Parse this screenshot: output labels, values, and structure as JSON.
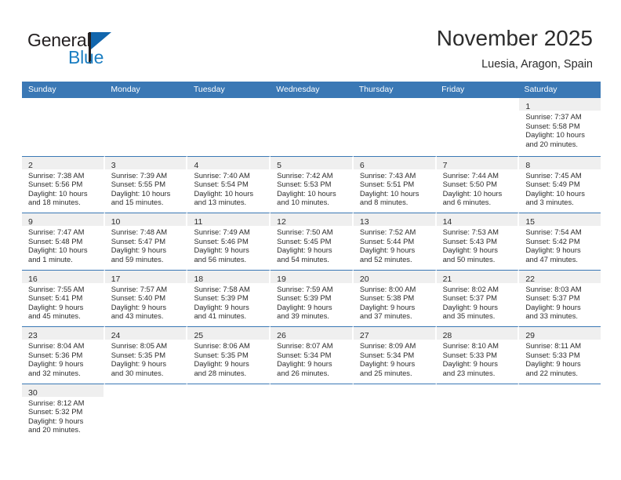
{
  "brand": {
    "name_part1": "General",
    "name_part2": "Blue",
    "accent_color": "#1b7ec2",
    "flag_color": "#1266ad"
  },
  "header": {
    "title": "November 2025",
    "subtitle": "Luesia, Aragon, Spain"
  },
  "theme": {
    "header_bar_color": "#3a78b5",
    "daynum_band_color": "#efefef",
    "row_separator_color": "#3a78b5",
    "text_color": "#2c2c2c"
  },
  "weekdays": [
    "Sunday",
    "Monday",
    "Tuesday",
    "Wednesday",
    "Thursday",
    "Friday",
    "Saturday"
  ],
  "weeks": [
    [
      {
        "day": "",
        "sunrise": "",
        "sunset": "",
        "daylight1": "",
        "daylight2": "",
        "empty": true
      },
      {
        "day": "",
        "sunrise": "",
        "sunset": "",
        "daylight1": "",
        "daylight2": "",
        "empty": true
      },
      {
        "day": "",
        "sunrise": "",
        "sunset": "",
        "daylight1": "",
        "daylight2": "",
        "empty": true
      },
      {
        "day": "",
        "sunrise": "",
        "sunset": "",
        "daylight1": "",
        "daylight2": "",
        "empty": true
      },
      {
        "day": "",
        "sunrise": "",
        "sunset": "",
        "daylight1": "",
        "daylight2": "",
        "empty": true
      },
      {
        "day": "",
        "sunrise": "",
        "sunset": "",
        "daylight1": "",
        "daylight2": "",
        "empty": true
      },
      {
        "day": "1",
        "sunrise": "Sunrise: 7:37 AM",
        "sunset": "Sunset: 5:58 PM",
        "daylight1": "Daylight: 10 hours",
        "daylight2": "and 20 minutes."
      }
    ],
    [
      {
        "day": "2",
        "sunrise": "Sunrise: 7:38 AM",
        "sunset": "Sunset: 5:56 PM",
        "daylight1": "Daylight: 10 hours",
        "daylight2": "and 18 minutes."
      },
      {
        "day": "3",
        "sunrise": "Sunrise: 7:39 AM",
        "sunset": "Sunset: 5:55 PM",
        "daylight1": "Daylight: 10 hours",
        "daylight2": "and 15 minutes."
      },
      {
        "day": "4",
        "sunrise": "Sunrise: 7:40 AM",
        "sunset": "Sunset: 5:54 PM",
        "daylight1": "Daylight: 10 hours",
        "daylight2": "and 13 minutes."
      },
      {
        "day": "5",
        "sunrise": "Sunrise: 7:42 AM",
        "sunset": "Sunset: 5:53 PM",
        "daylight1": "Daylight: 10 hours",
        "daylight2": "and 10 minutes."
      },
      {
        "day": "6",
        "sunrise": "Sunrise: 7:43 AM",
        "sunset": "Sunset: 5:51 PM",
        "daylight1": "Daylight: 10 hours",
        "daylight2": "and 8 minutes."
      },
      {
        "day": "7",
        "sunrise": "Sunrise: 7:44 AM",
        "sunset": "Sunset: 5:50 PM",
        "daylight1": "Daylight: 10 hours",
        "daylight2": "and 6 minutes."
      },
      {
        "day": "8",
        "sunrise": "Sunrise: 7:45 AM",
        "sunset": "Sunset: 5:49 PM",
        "daylight1": "Daylight: 10 hours",
        "daylight2": "and 3 minutes."
      }
    ],
    [
      {
        "day": "9",
        "sunrise": "Sunrise: 7:47 AM",
        "sunset": "Sunset: 5:48 PM",
        "daylight1": "Daylight: 10 hours",
        "daylight2": "and 1 minute."
      },
      {
        "day": "10",
        "sunrise": "Sunrise: 7:48 AM",
        "sunset": "Sunset: 5:47 PM",
        "daylight1": "Daylight: 9 hours",
        "daylight2": "and 59 minutes."
      },
      {
        "day": "11",
        "sunrise": "Sunrise: 7:49 AM",
        "sunset": "Sunset: 5:46 PM",
        "daylight1": "Daylight: 9 hours",
        "daylight2": "and 56 minutes."
      },
      {
        "day": "12",
        "sunrise": "Sunrise: 7:50 AM",
        "sunset": "Sunset: 5:45 PM",
        "daylight1": "Daylight: 9 hours",
        "daylight2": "and 54 minutes."
      },
      {
        "day": "13",
        "sunrise": "Sunrise: 7:52 AM",
        "sunset": "Sunset: 5:44 PM",
        "daylight1": "Daylight: 9 hours",
        "daylight2": "and 52 minutes."
      },
      {
        "day": "14",
        "sunrise": "Sunrise: 7:53 AM",
        "sunset": "Sunset: 5:43 PM",
        "daylight1": "Daylight: 9 hours",
        "daylight2": "and 50 minutes."
      },
      {
        "day": "15",
        "sunrise": "Sunrise: 7:54 AM",
        "sunset": "Sunset: 5:42 PM",
        "daylight1": "Daylight: 9 hours",
        "daylight2": "and 47 minutes."
      }
    ],
    [
      {
        "day": "16",
        "sunrise": "Sunrise: 7:55 AM",
        "sunset": "Sunset: 5:41 PM",
        "daylight1": "Daylight: 9 hours",
        "daylight2": "and 45 minutes."
      },
      {
        "day": "17",
        "sunrise": "Sunrise: 7:57 AM",
        "sunset": "Sunset: 5:40 PM",
        "daylight1": "Daylight: 9 hours",
        "daylight2": "and 43 minutes."
      },
      {
        "day": "18",
        "sunrise": "Sunrise: 7:58 AM",
        "sunset": "Sunset: 5:39 PM",
        "daylight1": "Daylight: 9 hours",
        "daylight2": "and 41 minutes."
      },
      {
        "day": "19",
        "sunrise": "Sunrise: 7:59 AM",
        "sunset": "Sunset: 5:39 PM",
        "daylight1": "Daylight: 9 hours",
        "daylight2": "and 39 minutes."
      },
      {
        "day": "20",
        "sunrise": "Sunrise: 8:00 AM",
        "sunset": "Sunset: 5:38 PM",
        "daylight1": "Daylight: 9 hours",
        "daylight2": "and 37 minutes."
      },
      {
        "day": "21",
        "sunrise": "Sunrise: 8:02 AM",
        "sunset": "Sunset: 5:37 PM",
        "daylight1": "Daylight: 9 hours",
        "daylight2": "and 35 minutes."
      },
      {
        "day": "22",
        "sunrise": "Sunrise: 8:03 AM",
        "sunset": "Sunset: 5:37 PM",
        "daylight1": "Daylight: 9 hours",
        "daylight2": "and 33 minutes."
      }
    ],
    [
      {
        "day": "23",
        "sunrise": "Sunrise: 8:04 AM",
        "sunset": "Sunset: 5:36 PM",
        "daylight1": "Daylight: 9 hours",
        "daylight2": "and 32 minutes."
      },
      {
        "day": "24",
        "sunrise": "Sunrise: 8:05 AM",
        "sunset": "Sunset: 5:35 PM",
        "daylight1": "Daylight: 9 hours",
        "daylight2": "and 30 minutes."
      },
      {
        "day": "25",
        "sunrise": "Sunrise: 8:06 AM",
        "sunset": "Sunset: 5:35 PM",
        "daylight1": "Daylight: 9 hours",
        "daylight2": "and 28 minutes."
      },
      {
        "day": "26",
        "sunrise": "Sunrise: 8:07 AM",
        "sunset": "Sunset: 5:34 PM",
        "daylight1": "Daylight: 9 hours",
        "daylight2": "and 26 minutes."
      },
      {
        "day": "27",
        "sunrise": "Sunrise: 8:09 AM",
        "sunset": "Sunset: 5:34 PM",
        "daylight1": "Daylight: 9 hours",
        "daylight2": "and 25 minutes."
      },
      {
        "day": "28",
        "sunrise": "Sunrise: 8:10 AM",
        "sunset": "Sunset: 5:33 PM",
        "daylight1": "Daylight: 9 hours",
        "daylight2": "and 23 minutes."
      },
      {
        "day": "29",
        "sunrise": "Sunrise: 8:11 AM",
        "sunset": "Sunset: 5:33 PM",
        "daylight1": "Daylight: 9 hours",
        "daylight2": "and 22 minutes."
      }
    ],
    [
      {
        "day": "30",
        "sunrise": "Sunrise: 8:12 AM",
        "sunset": "Sunset: 5:32 PM",
        "daylight1": "Daylight: 9 hours",
        "daylight2": "and 20 minutes."
      },
      {
        "day": "",
        "sunrise": "",
        "sunset": "",
        "daylight1": "",
        "daylight2": "",
        "empty": true
      },
      {
        "day": "",
        "sunrise": "",
        "sunset": "",
        "daylight1": "",
        "daylight2": "",
        "empty": true
      },
      {
        "day": "",
        "sunrise": "",
        "sunset": "",
        "daylight1": "",
        "daylight2": "",
        "empty": true
      },
      {
        "day": "",
        "sunrise": "",
        "sunset": "",
        "daylight1": "",
        "daylight2": "",
        "empty": true
      },
      {
        "day": "",
        "sunrise": "",
        "sunset": "",
        "daylight1": "",
        "daylight2": "",
        "empty": true
      },
      {
        "day": "",
        "sunrise": "",
        "sunset": "",
        "daylight1": "",
        "daylight2": "",
        "empty": true
      }
    ]
  ]
}
